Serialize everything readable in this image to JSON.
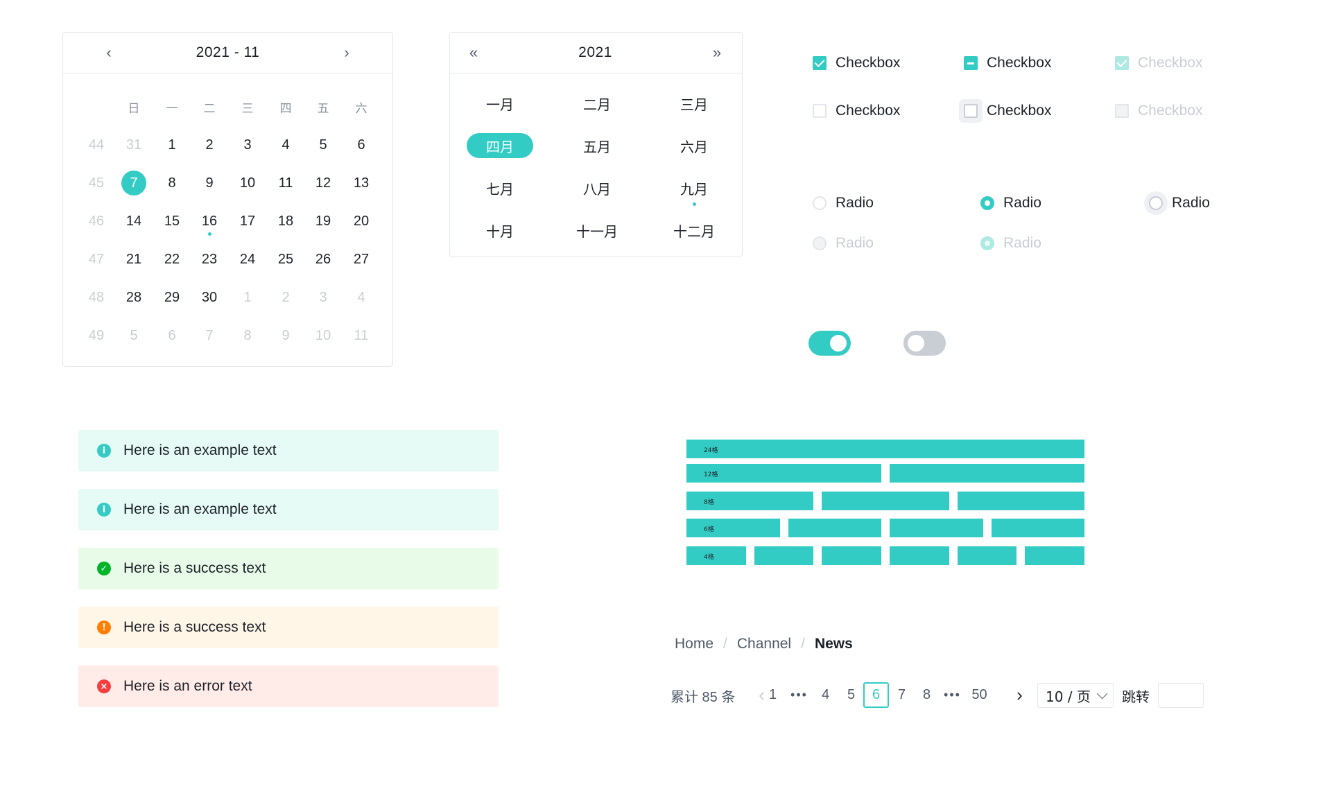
{
  "date_calendar": {
    "title": "2021 - 11",
    "prev_icon": "‹",
    "next_icon": "›",
    "weekdays": [
      "日",
      "一",
      "二",
      "三",
      "四",
      "五",
      "六"
    ],
    "weeks": [
      {
        "num": "44",
        "days": [
          {
            "d": "31",
            "dim": true
          },
          {
            "d": "1"
          },
          {
            "d": "2"
          },
          {
            "d": "3"
          },
          {
            "d": "4"
          },
          {
            "d": "5"
          },
          {
            "d": "6"
          }
        ]
      },
      {
        "num": "45",
        "days": [
          {
            "d": "7",
            "selected": true
          },
          {
            "d": "8"
          },
          {
            "d": "9"
          },
          {
            "d": "10"
          },
          {
            "d": "11"
          },
          {
            "d": "12"
          },
          {
            "d": "13"
          }
        ]
      },
      {
        "num": "46",
        "days": [
          {
            "d": "14"
          },
          {
            "d": "15"
          },
          {
            "d": "16",
            "today": true
          },
          {
            "d": "17"
          },
          {
            "d": "18"
          },
          {
            "d": "19"
          },
          {
            "d": "20"
          }
        ]
      },
      {
        "num": "47",
        "days": [
          {
            "d": "21"
          },
          {
            "d": "22"
          },
          {
            "d": "23"
          },
          {
            "d": "24"
          },
          {
            "d": "25"
          },
          {
            "d": "26"
          },
          {
            "d": "27"
          }
        ]
      },
      {
        "num": "48",
        "days": [
          {
            "d": "28"
          },
          {
            "d": "29"
          },
          {
            "d": "30"
          },
          {
            "d": "1",
            "dim": true
          },
          {
            "d": "2",
            "dim": true
          },
          {
            "d": "3",
            "dim": true
          },
          {
            "d": "4",
            "dim": true
          }
        ]
      },
      {
        "num": "49",
        "days": [
          {
            "d": "5",
            "dim": true
          },
          {
            "d": "6",
            "dim": true
          },
          {
            "d": "7",
            "dim": true
          },
          {
            "d": "8",
            "dim": true
          },
          {
            "d": "9",
            "dim": true
          },
          {
            "d": "10",
            "dim": true
          },
          {
            "d": "11",
            "dim": true
          }
        ]
      }
    ]
  },
  "month_calendar": {
    "title": "2021",
    "prev_icon": "«",
    "next_icon": "»",
    "months": [
      {
        "label": "一月"
      },
      {
        "label": "二月"
      },
      {
        "label": "三月"
      },
      {
        "label": "四月",
        "selected": true
      },
      {
        "label": "五月"
      },
      {
        "label": "六月"
      },
      {
        "label": "七月"
      },
      {
        "label": "八月"
      },
      {
        "label": "九月",
        "current": true
      },
      {
        "label": "十月"
      },
      {
        "label": "十一月"
      },
      {
        "label": "十二月"
      }
    ]
  },
  "checkboxes": [
    {
      "label": "Checkbox",
      "state": "checked"
    },
    {
      "label": "Checkbox",
      "state": "indeterminate"
    },
    {
      "label": "Checkbox",
      "state": "disabled-checked"
    },
    {
      "label": "Checkbox",
      "state": "unchecked"
    },
    {
      "label": "Checkbox",
      "state": "hover"
    },
    {
      "label": "Checkbox",
      "state": "disabled-unchecked"
    }
  ],
  "radios": [
    {
      "label": "Radio",
      "state": "unchecked"
    },
    {
      "label": "Radio",
      "state": "checked"
    },
    {
      "label": "Radio",
      "state": "hover"
    },
    {
      "label": "Radio",
      "state": "disabled-unchecked"
    },
    {
      "label": "Radio",
      "state": "disabled-checked"
    }
  ],
  "switches": [
    {
      "state": "on"
    },
    {
      "state": "off"
    }
  ],
  "alerts": [
    {
      "type": "info",
      "icon": "i",
      "icon_color": "#33ccc4",
      "bg": "#e6fbf6",
      "text": "Here is an example text"
    },
    {
      "type": "info",
      "icon": "i",
      "icon_color": "#33ccc4",
      "bg": "#e6fbf6",
      "text": "Here is an example text"
    },
    {
      "type": "success",
      "icon": "✓",
      "icon_color": "#00b42a",
      "bg": "#e8fbe8",
      "text": "Here is a success text"
    },
    {
      "type": "warning",
      "icon": "!",
      "icon_color": "#ff7d00",
      "bg": "#fff6e8",
      "text": "Here is a success text"
    },
    {
      "type": "error",
      "icon": "×",
      "icon_color": "#f53f3f",
      "bg": "#ffece8",
      "text": "Here is an error text"
    }
  ],
  "grid_demo": {
    "color": "#33ccc4",
    "rows": [
      {
        "label": "24格",
        "columns": 1
      },
      {
        "label": "12格",
        "columns": 2
      },
      {
        "label": "8格",
        "columns": 3
      },
      {
        "label": "6格",
        "columns": 4
      },
      {
        "label": "4格",
        "columns": 6
      }
    ]
  },
  "breadcrumb": {
    "items": [
      "Home",
      "Channel",
      "News"
    ],
    "separator": "/"
  },
  "pagination": {
    "total_text": "累计 85 条",
    "prev_icon": "‹",
    "next_icon": "›",
    "items": [
      {
        "label": "1"
      },
      {
        "label": "•••",
        "ellipsis": true
      },
      {
        "label": "4"
      },
      {
        "label": "5"
      },
      {
        "label": "6",
        "active": true
      },
      {
        "label": "7"
      },
      {
        "label": "8"
      },
      {
        "label": "•••",
        "ellipsis": true
      },
      {
        "label": "50"
      }
    ],
    "page_size": "10 / 页",
    "jump_label": "跳转",
    "jump_value": ""
  },
  "theme": {
    "primary": "#33ccc4",
    "border": "#e5e6eb",
    "text": "#1d2129",
    "disabled": "#c9cdd4"
  }
}
